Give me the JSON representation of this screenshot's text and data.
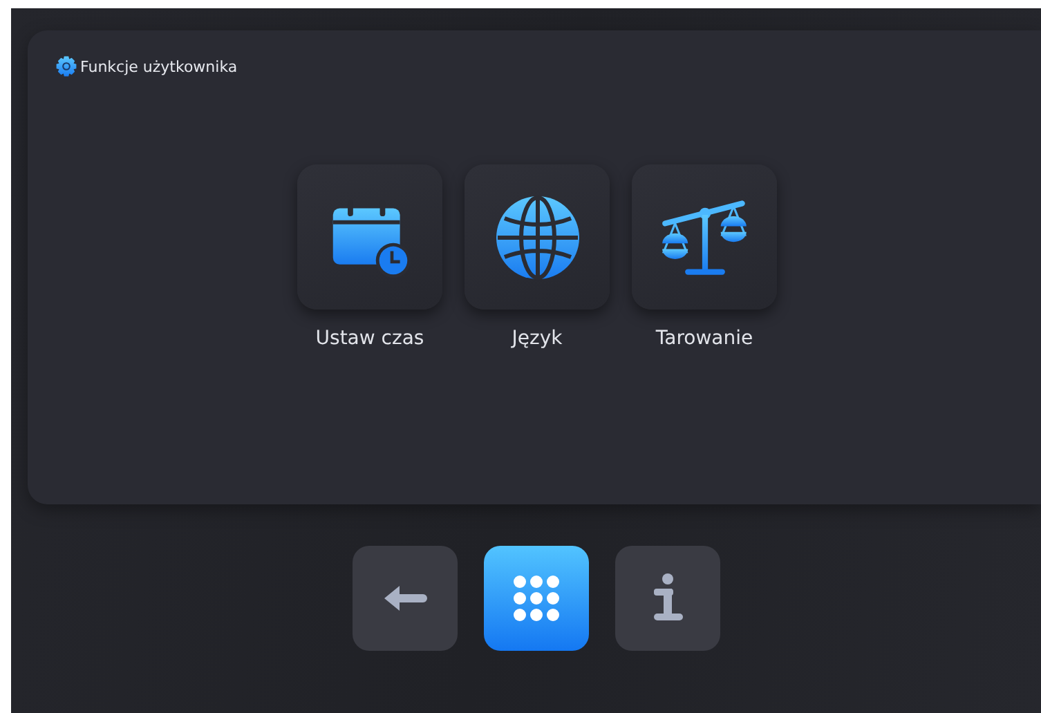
{
  "panel": {
    "title": "Funkcje użytkownika"
  },
  "functions": [
    {
      "kind": "calendar",
      "label": "Ustaw czas"
    },
    {
      "kind": "globe",
      "label": "Język"
    },
    {
      "kind": "scale",
      "label": "Tarowanie"
    }
  ],
  "nav": [
    {
      "kind": "back",
      "selected": false
    },
    {
      "kind": "apps",
      "selected": true
    },
    {
      "kind": "info",
      "selected": false
    }
  ]
}
